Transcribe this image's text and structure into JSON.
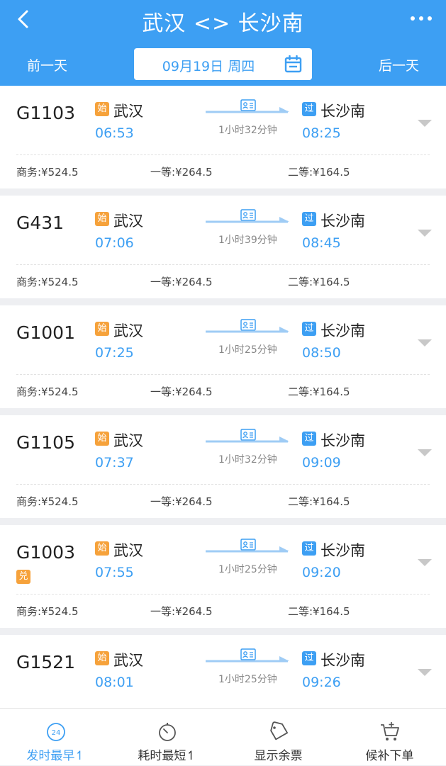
{
  "header": {
    "title": "武汉 <> 长沙南",
    "prev_day": "前一天",
    "next_day": "后一天",
    "date": "09月19日  周四"
  },
  "trains": [
    {
      "no": "G1103",
      "from_badge": "始",
      "from": "武汉",
      "dep": "06:53",
      "to_badge": "过",
      "to": "长沙南",
      "arr": "08:25",
      "duration": "1小时32分钟",
      "prices": [
        "商务:¥524.5",
        "一等:¥264.5",
        "二等:¥164.5"
      ]
    },
    {
      "no": "G431",
      "from_badge": "始",
      "from": "武汉",
      "dep": "07:06",
      "to_badge": "过",
      "to": "长沙南",
      "arr": "08:45",
      "duration": "1小时39分钟",
      "prices": [
        "商务:¥524.5",
        "一等:¥264.5",
        "二等:¥164.5"
      ]
    },
    {
      "no": "G1001",
      "from_badge": "始",
      "from": "武汉",
      "dep": "07:25",
      "to_badge": "过",
      "to": "长沙南",
      "arr": "08:50",
      "duration": "1小时25分钟",
      "prices": [
        "商务:¥524.5",
        "一等:¥264.5",
        "二等:¥164.5"
      ]
    },
    {
      "no": "G1105",
      "from_badge": "始",
      "from": "武汉",
      "dep": "07:37",
      "to_badge": "过",
      "to": "长沙南",
      "arr": "09:09",
      "duration": "1小时32分钟",
      "prices": [
        "商务:¥524.5",
        "一等:¥264.5",
        "二等:¥164.5"
      ]
    },
    {
      "no": "G1003",
      "exchange": "兑",
      "from_badge": "始",
      "from": "武汉",
      "dep": "07:55",
      "to_badge": "过",
      "to": "长沙南",
      "arr": "09:20",
      "duration": "1小时25分钟",
      "prices": [
        "商务:¥524.5",
        "一等:¥264.5",
        "二等:¥164.5"
      ]
    },
    {
      "no": "G1521",
      "from_badge": "始",
      "from": "武汉",
      "dep": "08:01",
      "to_badge": "过",
      "to": "长沙南",
      "arr": "09:26",
      "duration": "1小时25分钟",
      "prices": []
    }
  ],
  "tabs": [
    {
      "label": "发时最早↿",
      "icon": "clock-24-icon",
      "active": true,
      "icon_text": "24"
    },
    {
      "label": "耗时最短↿",
      "icon": "stopwatch-icon",
      "active": false
    },
    {
      "label": "显示余票",
      "icon": "ticket-tag-icon",
      "active": false
    },
    {
      "label": "候补下单",
      "icon": "cart-plus-icon",
      "active": false
    }
  ],
  "colors": {
    "primary": "#3d9ff3",
    "origin_badge": "#f6a23b",
    "pass_badge": "#3d9ff3"
  }
}
